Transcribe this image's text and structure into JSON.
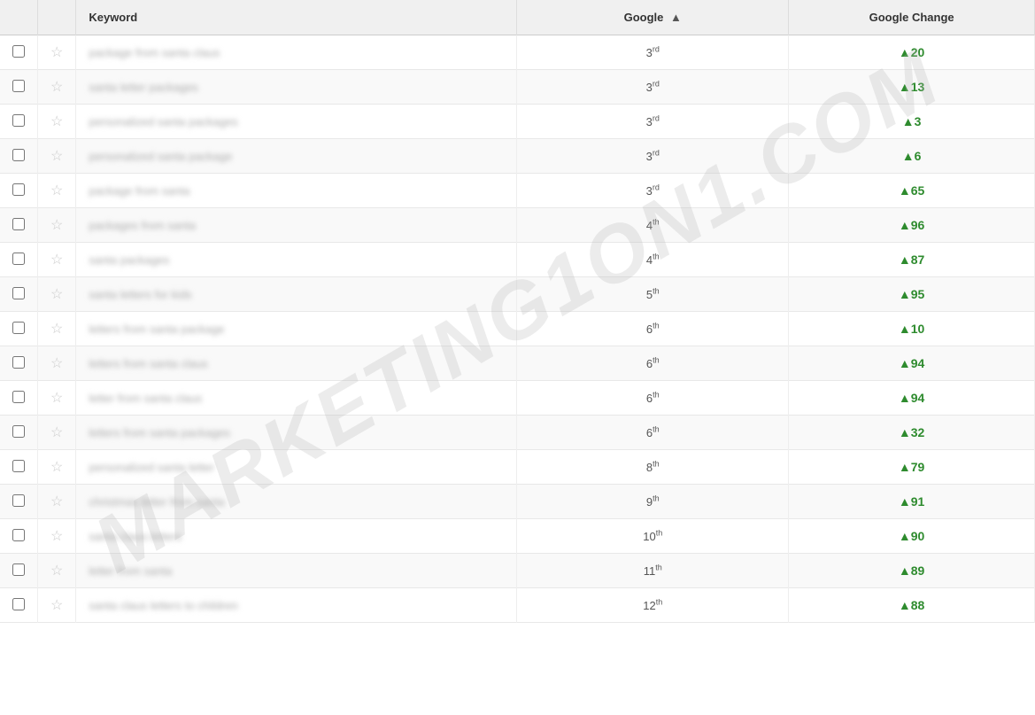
{
  "header": {
    "col_keyword": "Keyword",
    "col_google": "Google",
    "col_google_sort": "▲",
    "col_change": "Google Change"
  },
  "watermark": "MARKETING1ON1.COM",
  "rows": [
    {
      "keyword": "package from santa claus",
      "rank": "3",
      "rank_suffix": "rd",
      "change": "▲20"
    },
    {
      "keyword": "santa letter packages",
      "rank": "3",
      "rank_suffix": "rd",
      "change": "▲13"
    },
    {
      "keyword": "personalized santa packages",
      "rank": "3",
      "rank_suffix": "rd",
      "change": "▲3"
    },
    {
      "keyword": "personalized santa package",
      "rank": "3",
      "rank_suffix": "rd",
      "change": "▲6"
    },
    {
      "keyword": "package from santa",
      "rank": "3",
      "rank_suffix": "rd",
      "change": "▲65"
    },
    {
      "keyword": "packages from santa",
      "rank": "4",
      "rank_suffix": "th",
      "change": "▲96"
    },
    {
      "keyword": "santa packages",
      "rank": "4",
      "rank_suffix": "th",
      "change": "▲87"
    },
    {
      "keyword": "santa letters for kids",
      "rank": "5",
      "rank_suffix": "th",
      "change": "▲95"
    },
    {
      "keyword": "letters from santa package",
      "rank": "6",
      "rank_suffix": "th",
      "change": "▲10"
    },
    {
      "keyword": "letters from santa claus",
      "rank": "6",
      "rank_suffix": "th",
      "change": "▲94"
    },
    {
      "keyword": "letter from santa claus",
      "rank": "6",
      "rank_suffix": "th",
      "change": "▲94"
    },
    {
      "keyword": "letters from santa packages",
      "rank": "6",
      "rank_suffix": "th",
      "change": "▲32"
    },
    {
      "keyword": "personalized santa letter",
      "rank": "8",
      "rank_suffix": "th",
      "change": "▲79"
    },
    {
      "keyword": "christmas letter from santa",
      "rank": "9",
      "rank_suffix": "th",
      "change": "▲91"
    },
    {
      "keyword": "santa claus letters",
      "rank": "10",
      "rank_suffix": "th",
      "change": "▲90"
    },
    {
      "keyword": "letter from santa",
      "rank": "11",
      "rank_suffix": "th",
      "change": "▲89"
    },
    {
      "keyword": "santa claus letters to children",
      "rank": "12",
      "rank_suffix": "th",
      "change": "▲88"
    }
  ]
}
